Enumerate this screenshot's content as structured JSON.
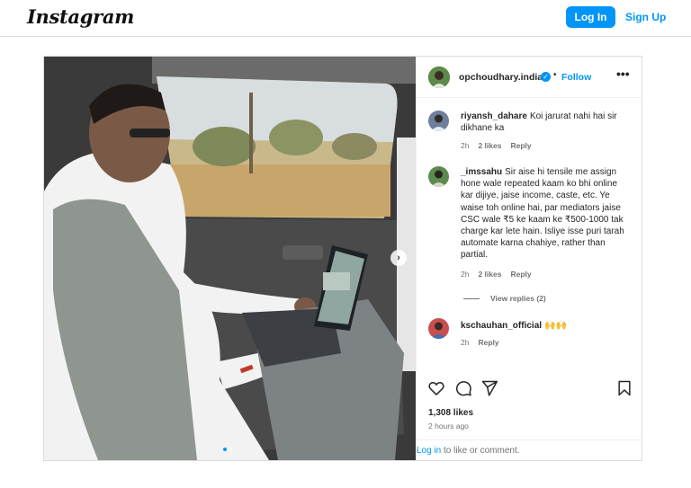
{
  "header": {
    "logo_text": "Instagram",
    "login_label": "Log In",
    "signup_label": "Sign Up"
  },
  "post": {
    "owner": {
      "username": "opchoudhary.india",
      "separator": "•",
      "follow_label": "Follow",
      "more_label": "•••"
    },
    "carousel": {
      "next_label": "›",
      "slide_index": 1,
      "slide_count": 2
    },
    "comments": [
      {
        "username": "riyansh_dahare",
        "text": "Koi jarurat nahi hai sir dikhane ka",
        "time": "2h",
        "likes": "2 likes",
        "reply_label": "Reply"
      },
      {
        "username": "_imssahu",
        "text": "Sir aise hi tensile me assign hone wale repeated kaam ko bhi online kar dijiye, jaise income, caste, etc. Ye waise toh online hai, par mediators jaise CSC wale ₹5 ke kaam ke ₹500-1000 tak charge kar lete hain. Isliye isse puri tarah automate karna chahiye, rather than partial.",
        "time": "2h",
        "likes": "2 likes",
        "reply_label": "Reply",
        "view_replies": "View replies (2)"
      },
      {
        "username": "kschauhan_official",
        "text": "🙌🙌",
        "time": "2h",
        "reply_label": "Reply"
      }
    ],
    "likes": "1,308 likes",
    "posted": "2 hours ago",
    "login_prompt": {
      "link": "Log in",
      "rest": " to like or comment."
    }
  },
  "colors": {
    "accent": "#0095f6",
    "text": "#262626",
    "muted": "#737373",
    "border": "#dbdbdb"
  },
  "icons": [
    "heart-icon",
    "comment-icon",
    "share-icon",
    "bookmark-icon",
    "verified-icon",
    "more-icon"
  ]
}
